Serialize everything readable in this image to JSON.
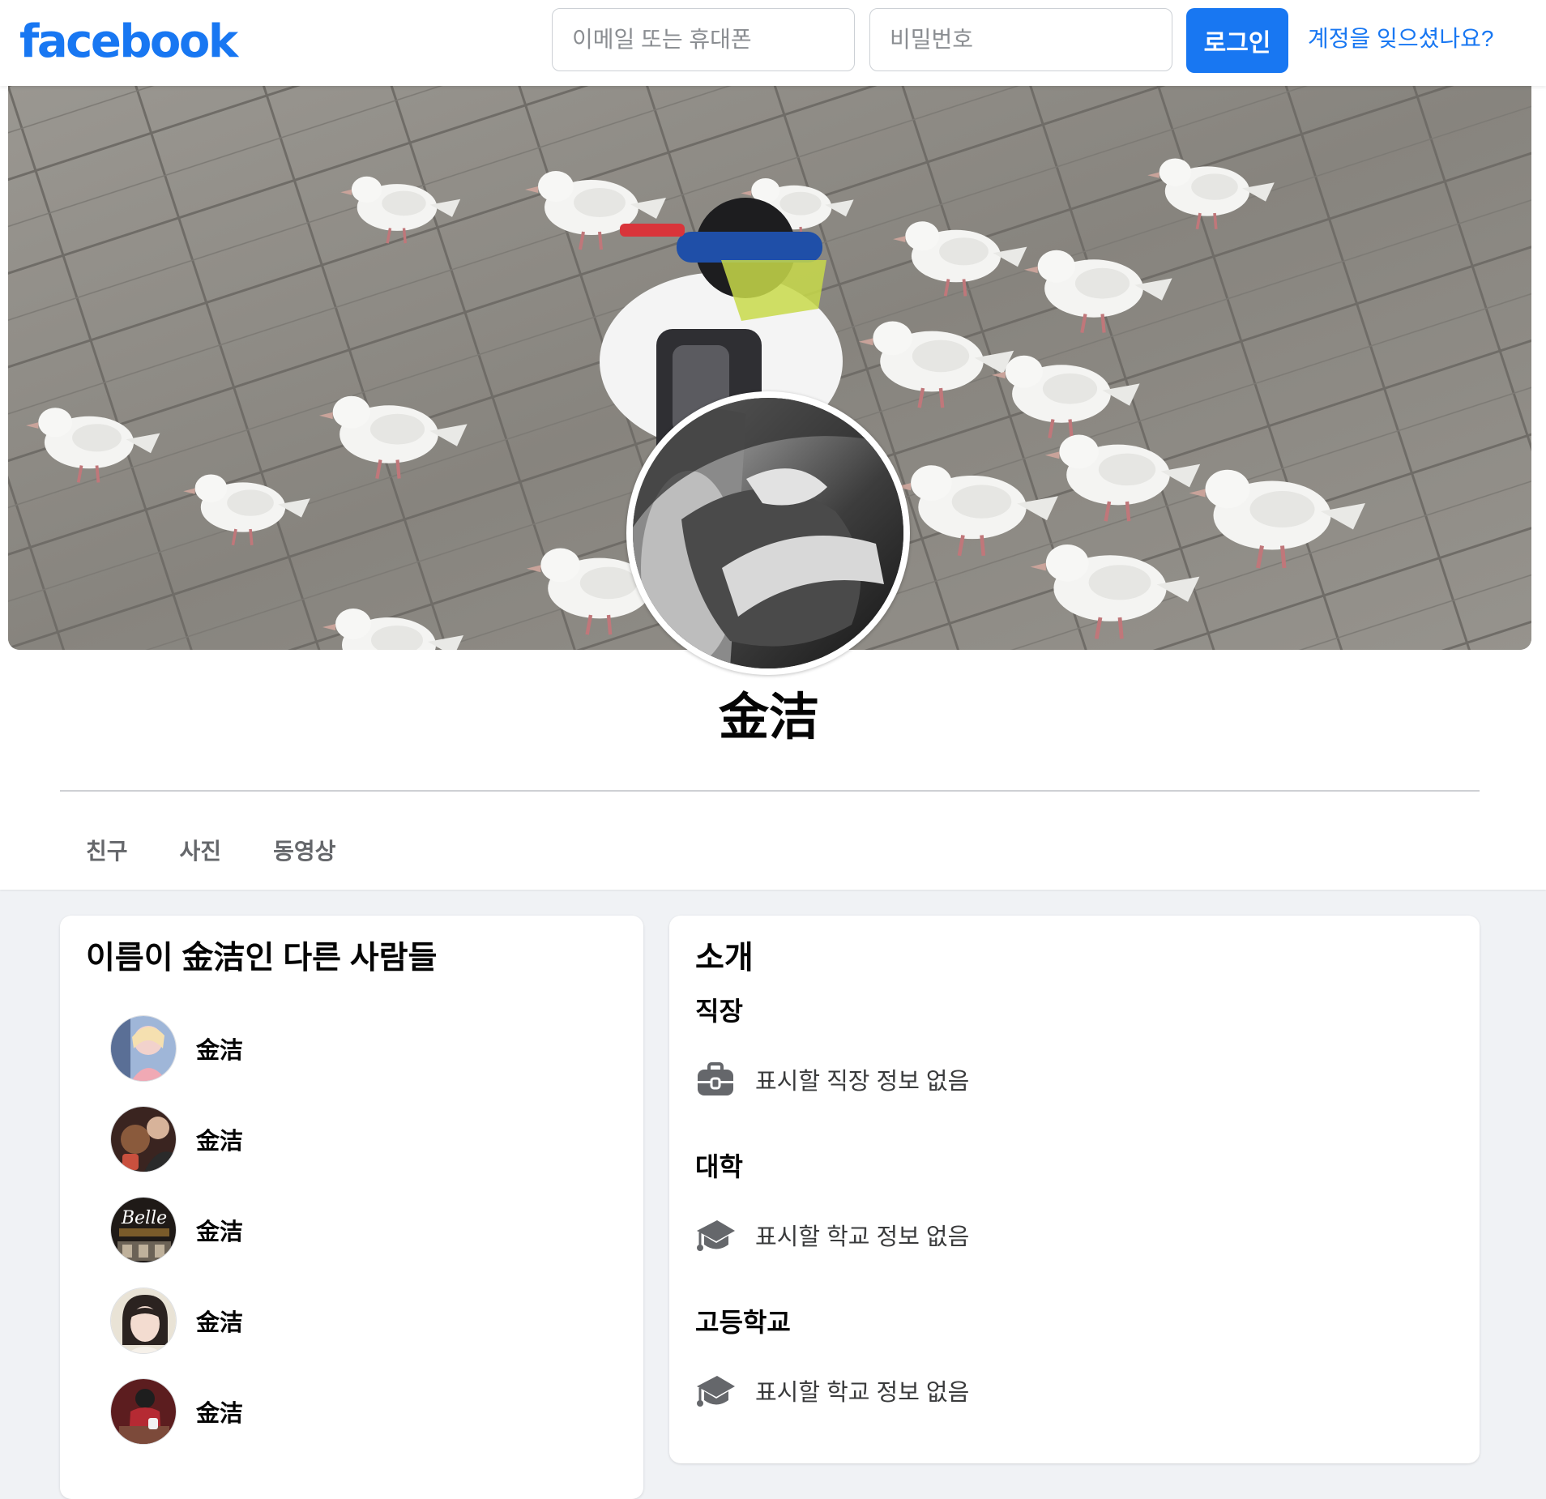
{
  "header": {
    "logo": "facebook",
    "email_placeholder": "이메일 또는 휴대폰",
    "password_placeholder": "비밀번호",
    "login_label": "로그인",
    "forgot_label": "계정을 잊으셨나요?"
  },
  "profile": {
    "name": "金洁",
    "tabs": [
      {
        "label": "친구"
      },
      {
        "label": "사진"
      },
      {
        "label": "동영상"
      }
    ]
  },
  "others": {
    "title": "이름이 金洁인 다른 사람들",
    "people": [
      {
        "name": "金洁"
      },
      {
        "name": "金洁"
      },
      {
        "name": "金洁"
      },
      {
        "name": "金洁"
      },
      {
        "name": "金洁"
      }
    ]
  },
  "intro": {
    "title": "소개",
    "sections": [
      {
        "heading": "직장",
        "icon": "briefcase-icon",
        "text": "표시할 직장 정보 없음"
      },
      {
        "heading": "대학",
        "icon": "graduation-cap-icon",
        "text": "표시할 학교 정보 없음"
      },
      {
        "heading": "고등학교",
        "icon": "graduation-cap-icon",
        "text": "표시할 학교 정보 없음"
      }
    ]
  },
  "colors": {
    "brand": "#1877f2",
    "page_background": "#f0f2f5",
    "secondary_text": "#65676b"
  }
}
